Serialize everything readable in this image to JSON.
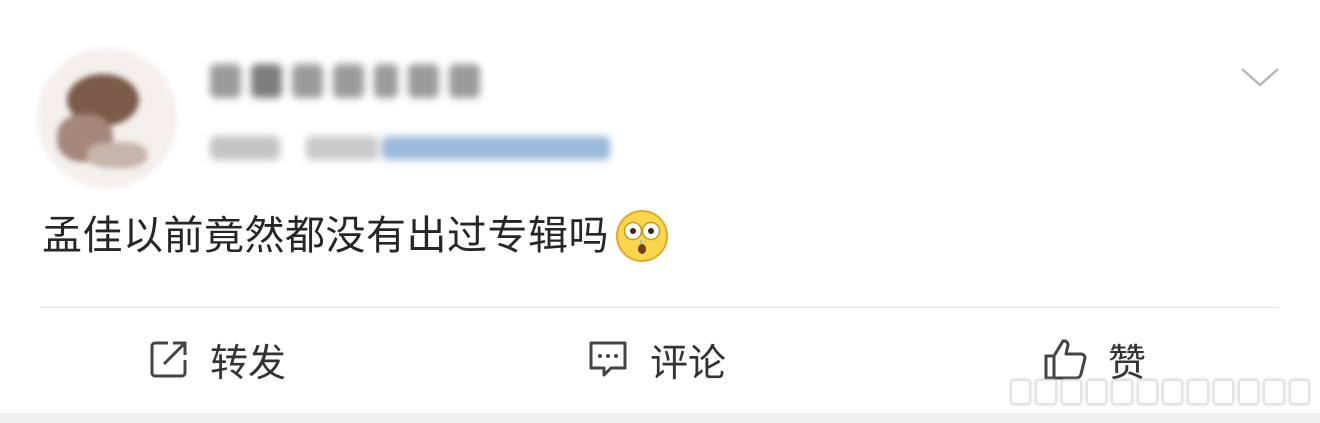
{
  "post": {
    "text": "孟佳以前竟然都没有出过专辑吗",
    "emoji": "face-with-open-mouth-and-tear-emoji"
  },
  "header": {
    "avatar_icon": "avatar-blurred",
    "menu_icon": "chevron-down-icon"
  },
  "actions": {
    "repost_label": "转发",
    "comment_label": "评论",
    "like_label": "赞"
  },
  "colors": {
    "text": "#262626",
    "divider": "#e6e6e6",
    "icon": "#444444",
    "meta_link": "#9ab9da"
  }
}
